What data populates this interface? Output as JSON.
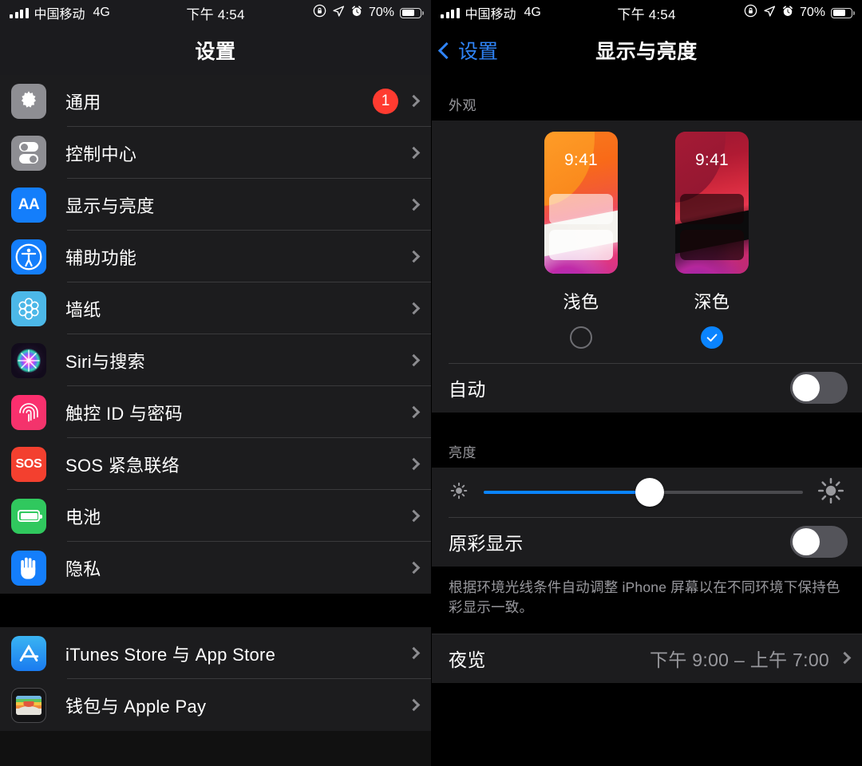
{
  "status_bar": {
    "carrier": "中国移动",
    "network": "4G",
    "time": "下午 4:54",
    "battery_percent": "70%",
    "icons": [
      "signal-bars-icon",
      "rotation-lock-icon",
      "location-arrow-icon",
      "alarm-clock-icon",
      "battery-icon"
    ]
  },
  "left_pane": {
    "nav_title": "设置",
    "groups": [
      {
        "items": [
          {
            "label": "通用",
            "icon": "gear-icon",
            "badge": "1"
          },
          {
            "label": "控制中心",
            "icon": "control-center-icon",
            "badge": ""
          },
          {
            "label": "显示与亮度",
            "icon": "display-brightness-icon",
            "badge": ""
          },
          {
            "label": "辅助功能",
            "icon": "accessibility-icon",
            "badge": ""
          },
          {
            "label": "墙纸",
            "icon": "wallpaper-icon",
            "badge": ""
          },
          {
            "label": "Siri与搜索",
            "icon": "siri-icon",
            "badge": ""
          },
          {
            "label": "触控 ID 与密码",
            "icon": "touch-id-icon",
            "badge": ""
          },
          {
            "label": "SOS 紧急联络",
            "icon": "sos-icon",
            "badge": ""
          },
          {
            "label": "电池",
            "icon": "battery-icon",
            "badge": ""
          },
          {
            "label": "隐私",
            "icon": "privacy-hand-icon",
            "badge": ""
          }
        ]
      },
      {
        "items": [
          {
            "label": "iTunes Store 与 App Store",
            "icon": "app-store-icon",
            "badge": ""
          },
          {
            "label": "钱包与 Apple Pay",
            "icon": "wallet-icon",
            "badge": ""
          }
        ]
      }
    ]
  },
  "right_pane": {
    "back_label": "设置",
    "nav_title": "显示与亮度",
    "appearance": {
      "header": "外观",
      "themes": [
        {
          "label": "浅色",
          "preview_time": "9:41",
          "selected": false
        },
        {
          "label": "深色",
          "preview_time": "9:41",
          "selected": true
        }
      ],
      "auto_label": "自动",
      "auto_on": false
    },
    "brightness": {
      "header": "亮度",
      "slider_percent": 52,
      "low_icon": "sun-low-icon",
      "high_icon": "sun-high-icon"
    },
    "true_tone": {
      "label": "原彩显示",
      "on": false,
      "description": "根据环境光线条件自动调整 iPhone 屏幕以在不同环境下保持色彩显示一致。"
    },
    "night_shift": {
      "label": "夜览",
      "value": "下午 9:00 – 上午 7:00"
    }
  },
  "colors": {
    "accent_blue": "#0a84ff",
    "badge_red": "#ff3b30",
    "panel": "#1c1c1e",
    "background": "#000000",
    "secondary_text": "#98989d"
  }
}
